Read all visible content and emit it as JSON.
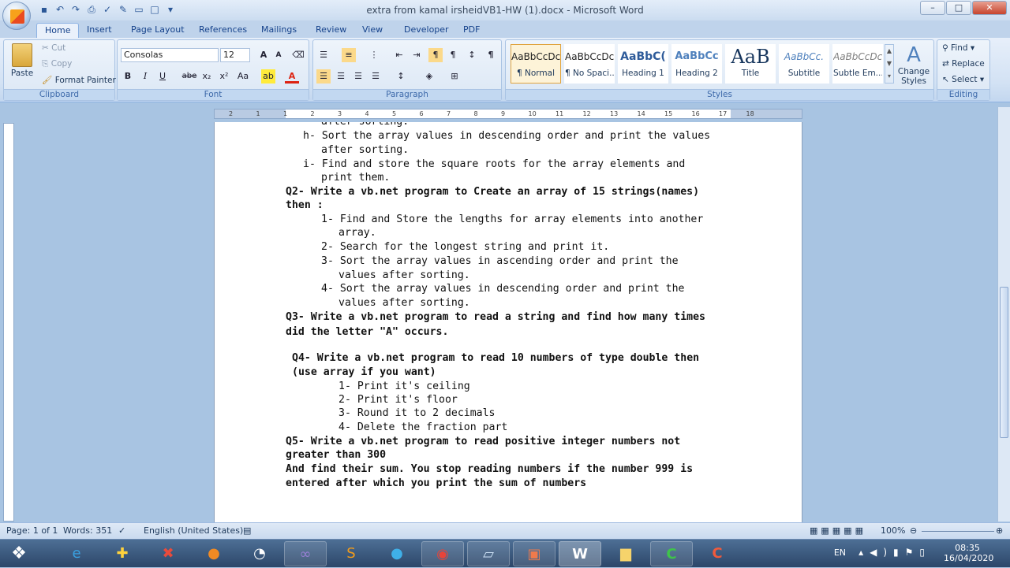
{
  "window": {
    "title": "extra from kamal irsheidVB1-HW (1).docx - Microsoft Word",
    "controls": [
      "–",
      "□",
      "✕"
    ]
  },
  "tabs": [
    "Home",
    "Insert",
    "Page Layout",
    "References",
    "Mailings",
    "Review",
    "View",
    "Developer",
    "PDF"
  ],
  "clipboard": {
    "paste": "Paste",
    "cut": "Cut",
    "copy": "Copy",
    "format_painter": "Format Painter",
    "label": "Clipboard"
  },
  "font": {
    "name": "Consolas",
    "size": "12",
    "label": "Font",
    "buttons": [
      "B",
      "I",
      "U",
      "abe",
      "x₂",
      "x²",
      "Aa"
    ]
  },
  "paragraph": {
    "label": "Paragraph"
  },
  "styles": {
    "label": "Styles",
    "items": [
      {
        "preview": "AaBbCcDc",
        "name": "¶ Normal"
      },
      {
        "preview": "AaBbCcDc",
        "name": "¶ No Spaci..."
      },
      {
        "preview": "AaBbC(",
        "name": "Heading 1"
      },
      {
        "preview": "AaBbCc",
        "name": "Heading 2"
      },
      {
        "preview": "AaB",
        "name": "Title"
      },
      {
        "preview": "AaBbCc.",
        "name": "Subtitle"
      },
      {
        "preview": "AaBbCcDc",
        "name": "Subtle Em..."
      }
    ],
    "change_styles": "Change Styles"
  },
  "editing": {
    "find": "Find",
    "replace": "Replace",
    "select": "Select",
    "label": "Editing"
  },
  "ruler": {
    "numbers": [
      "2",
      "1",
      "1",
      "2",
      "3",
      "4",
      "5",
      "6",
      "7",
      "8",
      "9",
      "10",
      "11",
      "12",
      "13",
      "14",
      "15",
      "16",
      "17",
      "18"
    ]
  },
  "document": {
    "lines": [
      "after sorting.",
      "h- Sort the array values in descending order and print the values",
      "after sorting.",
      "i- Find and store the square roots for the array elements and",
      "print them.",
      "Q2- Write a vb.net program to Create an array of 15 strings(names)",
      "then :",
      "1- Find and Store the lengths for array elements into another",
      "array.",
      "2- Search for the longest string and print it.",
      "3- Sort the array values in ascending order and print the",
      "values after sorting.",
      "4- Sort the array values in descending order and print the",
      "values after sorting.",
      "Q3- Write a vb.net program to read a string and find how many times",
      "did the letter \"A\" occurs.",
      "Q4- Write a vb.net program to read 10 numbers of type double then",
      "(use array if you want)",
      "1- Print it's ceiling",
      "2- Print it's floor",
      "3- Round it to 2 decimals",
      "4- Delete the fraction part",
      "Q5- Write a vb.net program to read positive integer numbers not",
      "greater than 300",
      "And find their sum. You stop reading numbers if the number 999 is",
      "entered after which you print the sum of numbers"
    ]
  },
  "status": {
    "page": "Page: 1 of 1",
    "words": "Words: 351",
    "language": "English (United States)",
    "zoom": "100%"
  },
  "tray": {
    "lang": "EN",
    "time": "08:35",
    "date": "16/04/2020"
  }
}
